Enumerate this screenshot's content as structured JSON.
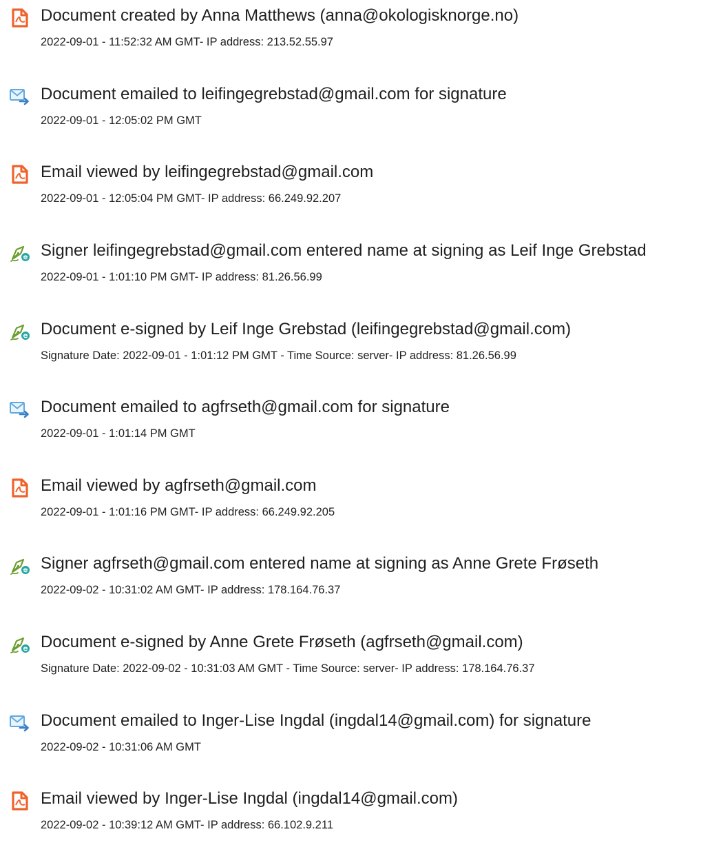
{
  "events": [
    {
      "icon": "document-created-icon",
      "title": "Document created by Anna Matthews (anna@okologisknorge.no)",
      "detail": "2022-09-01 - 11:52:32 AM GMT- IP address: 213.52.55.97"
    },
    {
      "icon": "email-sent-icon",
      "title": "Document emailed to leifingegrebstad@gmail.com for signature",
      "detail": "2022-09-01 - 12:05:02 PM GMT"
    },
    {
      "icon": "document-viewed-icon",
      "title": "Email viewed by leifingegrebstad@gmail.com",
      "detail": "2022-09-01 - 12:05:04 PM GMT- IP address: 66.249.92.207"
    },
    {
      "icon": "e-signature-pen-icon",
      "title": "Signer leifingegrebstad@gmail.com entered name at signing as Leif Inge Grebstad",
      "detail": "2022-09-01 - 1:01:10 PM GMT- IP address: 81.26.56.99"
    },
    {
      "icon": "e-signature-pen-icon",
      "title": "Document e-signed by Leif Inge Grebstad (leifingegrebstad@gmail.com)",
      "detail": "Signature Date: 2022-09-01 - 1:01:12 PM GMT - Time Source: server- IP address: 81.26.56.99"
    },
    {
      "icon": "email-sent-icon",
      "title": "Document emailed to agfrseth@gmail.com for signature",
      "detail": "2022-09-01 - 1:01:14 PM GMT"
    },
    {
      "icon": "document-viewed-icon",
      "title": "Email viewed by agfrseth@gmail.com",
      "detail": "2022-09-01 - 1:01:16 PM GMT- IP address: 66.249.92.205"
    },
    {
      "icon": "e-signature-pen-icon",
      "title": "Signer agfrseth@gmail.com entered name at signing as Anne Grete Frøseth",
      "detail": "2022-09-02 - 10:31:02 AM GMT- IP address: 178.164.76.37"
    },
    {
      "icon": "e-signature-pen-icon",
      "title": "Document e-signed by Anne Grete Frøseth (agfrseth@gmail.com)",
      "detail": "Signature Date: 2022-09-02 - 10:31:03 AM GMT - Time Source: server- IP address: 178.164.76.37"
    },
    {
      "icon": "email-sent-icon",
      "title": "Document emailed to Inger-Lise Ingdal (ingdal14@gmail.com) for signature",
      "detail": "2022-09-02 - 10:31:06 AM GMT"
    },
    {
      "icon": "document-viewed-icon",
      "title": "Email viewed by Inger-Lise Ingdal (ingdal14@gmail.com)",
      "detail": "2022-09-02 - 10:39:12 AM GMT- IP address: 66.102.9.211"
    }
  ],
  "colors": {
    "document_icon": "#f0622b",
    "email_icon_envelope": "#5fa9e0",
    "email_icon_arrow": "#3b7fc9",
    "pen_icon": "#6b9e2f",
    "pen_badge": "#26a6a0",
    "text": "#1f1f1f"
  }
}
